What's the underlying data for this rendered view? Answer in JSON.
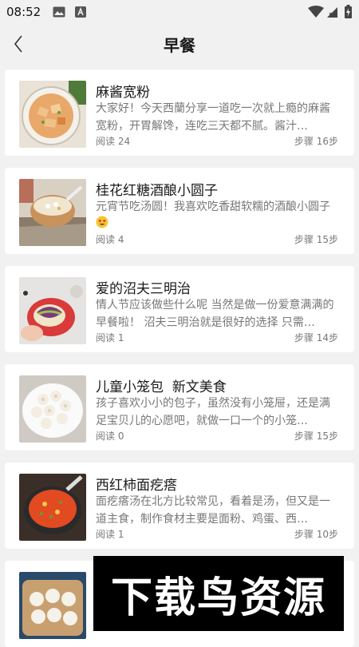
{
  "status_bar": {
    "time": "08:52"
  },
  "header": {
    "title": "早餐"
  },
  "recipes": [
    {
      "title": "麻酱宽粉",
      "desc": "大家好！今天西蘭分享一道吃一次就上瘾的麻酱宽粉，开胃解馋，连吃三天都不腻。酱汁…",
      "read_label": "阅读",
      "read_count": "24",
      "steps_label": "步骤",
      "steps": "16步"
    },
    {
      "title": "桂花红糖酒酿小圆子",
      "desc": "元宵节吃汤圆！我喜欢吃香甜软糯的酒酿小圆子",
      "read_label": "阅读",
      "read_count": "4",
      "steps_label": "步骤",
      "steps": "15步"
    },
    {
      "title": "爱的沼夫三明治",
      "desc": "情人节应该做些什么呢 当然是做一份爱意满满的早餐啦！ 沼夫三明治就是很好的选择 只需…",
      "read_label": "阅读",
      "read_count": "1",
      "steps_label": "步骤",
      "steps": "14步"
    },
    {
      "title": "儿童小笼包  新文美食",
      "desc": "孩子喜欢小小的包子，虽然没有小笼屉，还是满足宝贝儿的心愿吧，就做一口一个的小笼…",
      "read_label": "阅读",
      "read_count": "0",
      "steps_label": "步骤",
      "steps": "15步"
    },
    {
      "title": "西红柿面疙瘩",
      "desc": "面疙瘩汤在北方比较常见，看着是汤，但又是一道主食，制作食材主要是面粉、鸡蛋、西…",
      "read_label": "阅读",
      "read_count": "1",
      "steps_label": "步骤",
      "steps": "10步"
    }
  ],
  "watermark": {
    "text": "下载鸟资源"
  }
}
